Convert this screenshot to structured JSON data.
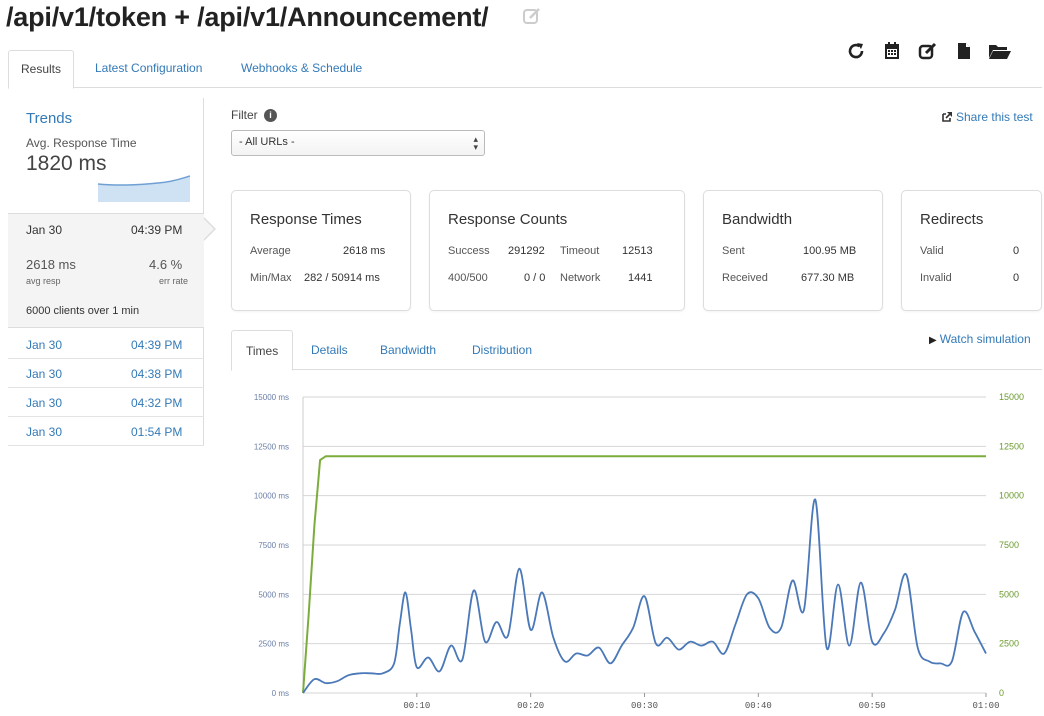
{
  "title": "/api/v1/token + /api/v1/Announcement/",
  "toolbar_icons": [
    "refresh-icon",
    "calendar-icon",
    "edit-icon",
    "file-icon",
    "folder-open-icon"
  ],
  "tabs": [
    "Results",
    "Latest Configuration",
    "Webhooks & Schedule"
  ],
  "sidebar": {
    "trends_title": "Trends",
    "trends_subtitle": "Avg. Response Time",
    "trends_value": "1820 ms",
    "selected": {
      "date": "Jan 30",
      "time": "04:39 PM",
      "avg_resp_value": "2618 ms",
      "avg_resp_label": "avg resp",
      "err_rate_value": "4.6 %",
      "err_rate_label": "err rate",
      "clients": "6000 clients over 1 min"
    },
    "runs": [
      {
        "date": "Jan 30",
        "time": "04:39 PM"
      },
      {
        "date": "Jan 30",
        "time": "04:38 PM"
      },
      {
        "date": "Jan 30",
        "time": "04:32 PM"
      },
      {
        "date": "Jan 30",
        "time": "01:54 PM"
      }
    ]
  },
  "filter": {
    "label": "Filter",
    "info": "i",
    "selected": "- All URLs -",
    "share": "Share this test"
  },
  "cards": {
    "response_times": {
      "title": "Response Times",
      "average_label": "Average",
      "average_value": "2618 ms",
      "minmax_label": "Min/Max",
      "minmax_value": "282 / 50914 ms"
    },
    "response_counts": {
      "title": "Response Counts",
      "success_label": "Success",
      "success_value": "291292",
      "timeout_label": "Timeout",
      "timeout_value": "12513",
      "errors_label": "400/500",
      "errors_value": "0 / 0",
      "network_label": "Network",
      "network_value": "1441"
    },
    "bandwidth": {
      "title": "Bandwidth",
      "sent_label": "Sent",
      "sent_value": "100.95 MB",
      "received_label": "Received",
      "received_value": "677.30 MB"
    },
    "redirects": {
      "title": "Redirects",
      "valid_label": "Valid",
      "valid_value": "0",
      "invalid_label": "Invalid",
      "invalid_value": "0"
    }
  },
  "chart_tabs": [
    "Times",
    "Details",
    "Bandwidth",
    "Distribution"
  ],
  "watch": "Watch simulation",
  "colors": {
    "link": "#337ab7",
    "response_line": "#4a78b8",
    "clients_line": "#7cad3c",
    "grid": "#d6d6d6"
  },
  "chart_data": {
    "type": "line",
    "x_ticks": [
      "00:10",
      "00:20",
      "00:30",
      "00:40",
      "00:50",
      "01:00"
    ],
    "y_left_ticks": [
      "0 ms",
      "2500 ms",
      "5000 ms",
      "7500 ms",
      "10000 ms",
      "12500 ms",
      "15000 ms"
    ],
    "y_right_ticks": [
      "0",
      "2500",
      "5000",
      "7500",
      "10000",
      "12500",
      "15000"
    ],
    "ylim": [
      0,
      15000
    ],
    "xlim": [
      0,
      60
    ],
    "grid": true,
    "series": [
      {
        "axis": "left",
        "x": [
          0,
          1,
          2,
          3,
          4,
          5,
          6,
          7,
          8,
          8.5,
          9,
          9.5,
          10,
          11,
          12,
          13,
          14,
          15,
          16,
          17,
          18,
          19,
          20,
          21,
          22,
          23,
          24,
          25,
          26,
          27,
          28,
          29,
          30,
          31,
          32,
          33,
          34,
          35,
          36,
          37,
          38,
          39,
          40,
          41,
          42,
          43,
          44,
          45,
          46,
          47,
          48,
          49,
          50,
          51,
          52,
          53,
          54,
          55,
          56,
          57,
          58,
          59,
          60
        ],
        "values": [
          0,
          700,
          500,
          600,
          900,
          1000,
          1000,
          1000,
          1500,
          3500,
          5100,
          3200,
          1300,
          1800,
          1100,
          2400,
          1700,
          5200,
          2600,
          3600,
          2900,
          6300,
          3200,
          5100,
          2800,
          1600,
          2000,
          1900,
          2300,
          1500,
          2400,
          3300,
          4900,
          2500,
          2800,
          2200,
          2600,
          2400,
          2600,
          2000,
          3500,
          5000,
          4800,
          3300,
          3300,
          5700,
          4200,
          9800,
          2300,
          5500,
          2400,
          5600,
          2600,
          3000,
          4200,
          6000,
          2300,
          1600,
          1500,
          1600,
          4100,
          3100,
          2000
        ]
      },
      {
        "axis": "right",
        "x": [
          0,
          0.5,
          1,
          1.5,
          2,
          60
        ],
        "values": [
          0,
          4000,
          8500,
          11800,
          12000,
          12000
        ]
      }
    ]
  }
}
